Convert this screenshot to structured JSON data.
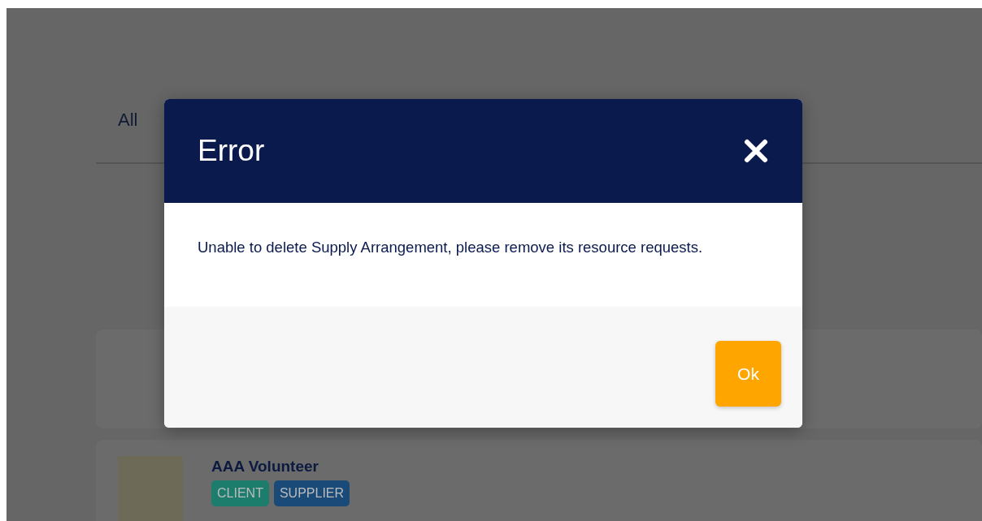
{
  "tabs": [
    {
      "label": "All"
    }
  ],
  "cards": [
    {
      "kind": "empty"
    },
    {
      "kind": "organization",
      "name": "AAA Volunteer",
      "tags": [
        {
          "label": "CLIENT",
          "color": "#1d7d6d"
        },
        {
          "label": "SUPPLIER",
          "color": "#1a4a78"
        }
      ]
    }
  ],
  "dialog": {
    "title": "Error",
    "message": "Unable to delete Supply Arrangement, please remove its resource requests.",
    "buttons": [
      "Ok"
    ]
  }
}
